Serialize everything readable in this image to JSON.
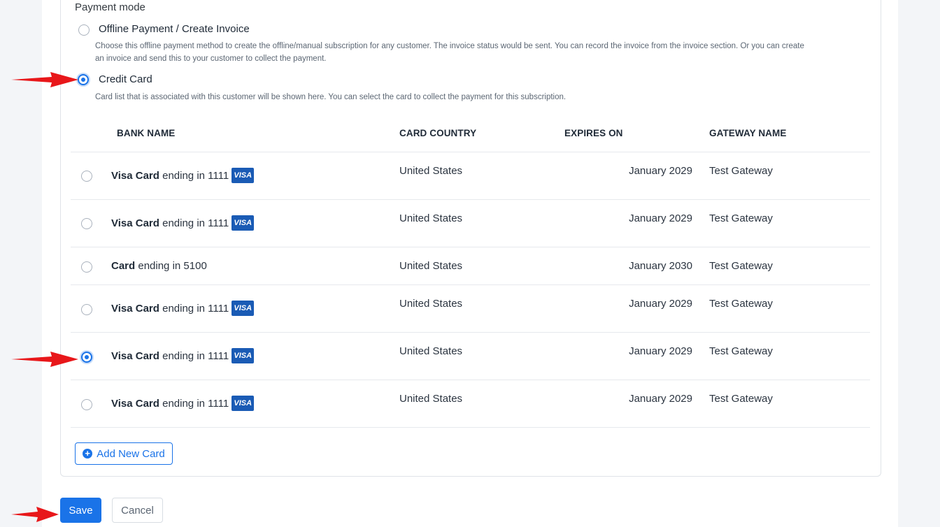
{
  "payment": {
    "section_label": "Payment mode",
    "offline": {
      "label": "Offline Payment / Create Invoice",
      "desc_line1": "Choose this offline payment method to create the offline/manual subscription for any customer. The invoice status would be sent. You can record the invoice from the invoice section. Or you can create",
      "desc_line2": "an invoice and send this to your customer to collect the payment.",
      "selected": false
    },
    "credit": {
      "label": "Credit Card",
      "desc": "Card list that is associated with this customer will be shown here. You can select the card to collect the payment for this subscription.",
      "selected": true
    }
  },
  "table": {
    "headers": {
      "bank": "BANK NAME",
      "country": "CARD COUNTRY",
      "expires": "EXPIRES ON",
      "gateway": "GATEWAY NAME"
    },
    "rows": [
      {
        "brand": "Visa Card",
        "suffix": "ending in 1111",
        "logo": "VISA",
        "country": "United States",
        "expires": "January 2029",
        "gateway": "Test Gateway",
        "selected": false
      },
      {
        "brand": "Visa Card",
        "suffix": "ending in 1111",
        "logo": "VISA",
        "country": "United States",
        "expires": "January 2029",
        "gateway": "Test Gateway",
        "selected": false
      },
      {
        "brand": "Card",
        "suffix": "ending in 5100",
        "logo": "",
        "country": "United States",
        "expires": "January 2030",
        "gateway": "Test Gateway",
        "selected": false
      },
      {
        "brand": "Visa Card",
        "suffix": "ending in 1111",
        "logo": "VISA",
        "country": "United States",
        "expires": "January 2029",
        "gateway": "Test Gateway",
        "selected": false
      },
      {
        "brand": "Visa Card",
        "suffix": "ending in 1111",
        "logo": "VISA",
        "country": "United States",
        "expires": "January 2029",
        "gateway": "Test Gateway",
        "selected": true
      },
      {
        "brand": "Visa Card",
        "suffix": "ending in 1111",
        "logo": "VISA",
        "country": "United States",
        "expires": "January 2029",
        "gateway": "Test Gateway",
        "selected": false
      }
    ]
  },
  "buttons": {
    "add_card": "Add New Card",
    "save": "Save",
    "cancel": "Cancel"
  },
  "colors": {
    "accent": "#1a73e8",
    "annotation_arrow": "#e8171a",
    "visa_badge": "#1a5bb5"
  },
  "icons": [
    "radio-icon",
    "visa-logo-icon",
    "plus-circle-icon",
    "annotation-arrow-icon"
  ]
}
